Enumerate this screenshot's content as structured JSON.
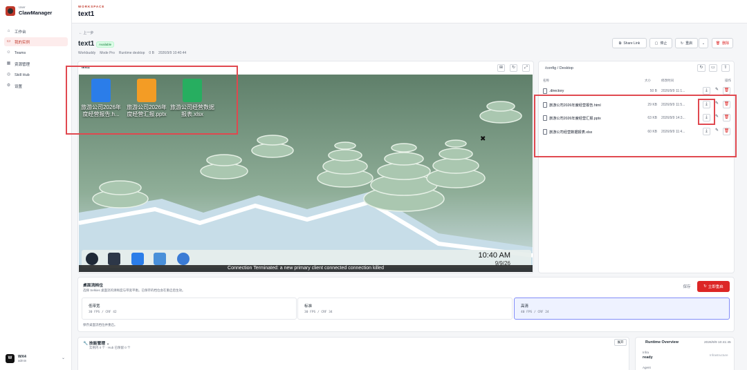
{
  "brand": {
    "small": "User",
    "name": "ClawManager"
  },
  "nav": [
    {
      "label": "工作台",
      "icon": "home-icon"
    },
    {
      "label": "我的实例",
      "icon": "instance-icon",
      "active": true
    },
    {
      "label": "Teams",
      "icon": "users-icon"
    },
    {
      "label": "资源管理",
      "icon": "grid-icon"
    },
    {
      "label": "Skill Hub",
      "icon": "skill-icon"
    },
    {
      "label": "设置",
      "icon": "gear-icon"
    }
  ],
  "user": {
    "initial": "W",
    "name": "WX4",
    "role": "admin"
  },
  "header": {
    "workspace": "WORKSPACE",
    "title": "text1"
  },
  "instance": {
    "back": "← 上一步",
    "name": "text1",
    "status": "Available",
    "meta": [
      "Workbuddy",
      "Mode Pro",
      "Runtime desktop",
      "0 B",
      "2026/9/9 10:40:44"
    ],
    "actions": {
      "share": "Share Link",
      "stop": "停止",
      "restart": "重启",
      "delete": "删除"
    }
  },
  "desktop": {
    "label": "text1",
    "icons": [
      {
        "label": "旅游公司2026年度经营报告.h...",
        "color": "#2b7de9"
      },
      {
        "label": "旅游公司2026年度经营汇报.pptx",
        "color": "#f39c25"
      },
      {
        "label": "旅游公司经营数据报表.xlsx",
        "color": "#27ae60"
      }
    ],
    "clock_time": "10:40 AM",
    "clock_date": "9/9/26",
    "connection_msg": "Connection Terminated: a new primary client connected connection killed"
  },
  "files": {
    "path": "/config / Desktop",
    "headers": {
      "name": "名称",
      "size": "大小",
      "modified": "修改时间",
      "actions": "操作"
    },
    "rows": [
      {
        "name": ".directory",
        "size": "50 B",
        "modified": "2026/9/9 11:1..."
      },
      {
        "name": "旅游公司2026年度经营报告.html",
        "size": "29 KB",
        "modified": "2026/9/9 11:5..."
      },
      {
        "name": "旅游公司2026年度经营汇报.pptx",
        "size": "63 KB",
        "modified": "2026/9/9 14:3..."
      },
      {
        "name": "旅游公司经营数据报表.xlsx",
        "size": "60 KB",
        "modified": "2026/9/9 11:4..."
      }
    ]
  },
  "quality": {
    "title": "桌面流档位",
    "desc": "选择 Selkies 桌面流的清晰度与带宽平衡。已保存的档位会在重启后生效。",
    "save": "保存",
    "restart": "立即重启",
    "options": [
      {
        "name": "低带宽",
        "spec": "30 FPS / CRF 42"
      },
      {
        "name": "标准",
        "spec": "30 FPS / CRF 34"
      },
      {
        "name": "高清",
        "spec": "40 FPS / CRF 24",
        "selected": true
      }
    ],
    "footer": "保存桌面流档位并重启。"
  },
  "skills": {
    "title": "技能管理",
    "sub": "实例内 0 个 · Hub 已保留 0 个",
    "expand": "展开"
  },
  "runtime": {
    "title": "Runtime Overview",
    "date": "2026/9/9 10:41:45",
    "k1": "Infra",
    "v1": "ready",
    "r1": "Infrastructure",
    "k2": "Agent"
  }
}
